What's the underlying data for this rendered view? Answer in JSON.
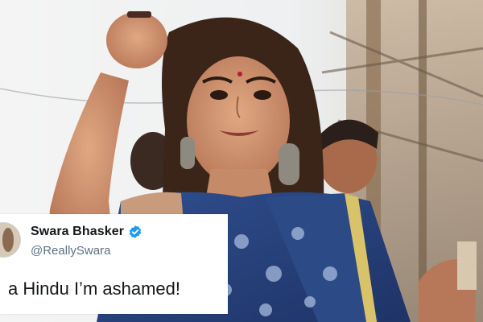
{
  "tweet": {
    "name": "Swara Bhasker",
    "handle": "@ReallySwara",
    "text": "a Hindu I’m ashamed!",
    "verified_icon": "verified-badge-icon",
    "verified_color": "#1d9bf0"
  }
}
